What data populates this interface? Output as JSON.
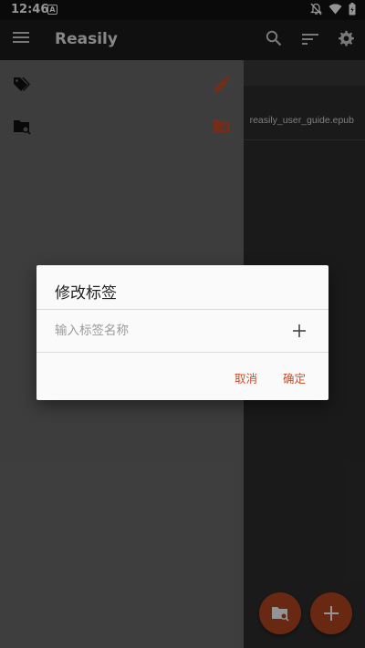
{
  "status_bar": {
    "time": "12:46",
    "notification_icon": "A",
    "icons": [
      "mute-notifications-icon",
      "wifi-icon",
      "battery-icon"
    ]
  },
  "toolbar": {
    "title": "Reasily",
    "icons": [
      "menu-icon",
      "search-icon",
      "sort-icon",
      "settings-icon"
    ]
  },
  "drawer": {
    "rows": [
      {
        "lead_icon": "tags-icon",
        "trail_icon": "edit-icon"
      },
      {
        "lead_icon": "folder-search-icon",
        "trail_icon": "folder-add-icon"
      }
    ]
  },
  "library": {
    "book_filename": "reasily_user_guide.epub"
  },
  "dialog": {
    "title": "修改标签",
    "input_placeholder": "输入标签名称",
    "input_value": "",
    "cancel_label": "取消",
    "confirm_label": "确定"
  },
  "colors": {
    "accent": "#c4502a",
    "fab": "#b3451f",
    "toolbar_bg": "#1d1d1d",
    "drawer_bg": "#6a6a6a",
    "dialog_bg": "#fafafa"
  }
}
